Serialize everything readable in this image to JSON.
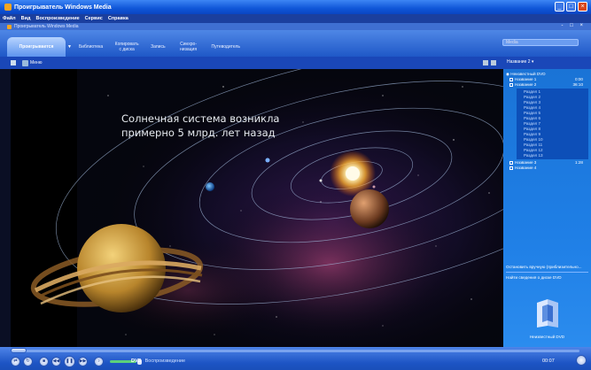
{
  "window": {
    "title": "Проигрыватель Windows Media"
  },
  "menubar": {
    "items": [
      "Файл",
      "Вид",
      "Воспроизведение",
      "Сервис",
      "Справка"
    ]
  },
  "subtitlebar": {
    "title": "Проигрыватель Windows Media"
  },
  "taskbar": {
    "tabs": [
      {
        "label": "Проигрывается"
      },
      {
        "label": "Библиотека"
      },
      {
        "label": "Копировать с диска"
      },
      {
        "label": "Запись"
      },
      {
        "label": "Синхро-низация"
      },
      {
        "label": "Путеводитель"
      }
    ],
    "search_placeholder": "Media"
  },
  "toolbar": {
    "menu_label": "Меню",
    "title_select": "Название 2"
  },
  "video": {
    "caption_line1": "Солнечная система возникла",
    "caption_line2": "примерно 5 млрд. лет назад"
  },
  "playlist": {
    "disc": "Неизвестный DVD",
    "titles": [
      {
        "name": "Название 1",
        "duration": "0:00"
      },
      {
        "name": "Название 2",
        "duration": "36:10"
      }
    ],
    "sections": [
      "Раздел 1",
      "Раздел 2",
      "Раздел 3",
      "Раздел 4",
      "Раздел 5",
      "Раздел 6",
      "Раздел 7",
      "Раздел 8",
      "Раздел 9",
      "Раздел 10",
      "Раздел 11",
      "Раздел 12",
      "Раздел 13"
    ],
    "more_titles": [
      {
        "name": "Название 3",
        "duration": "1:28"
      },
      {
        "name": "Название 4",
        "duration": ""
      }
    ],
    "stop_time": "Остановить вручную (приблизительно...",
    "find_info": "Найти сведения о диске DVD",
    "dvd_caption": "Неизвестный DVD"
  },
  "player": {
    "state_label": "Воспроизведение",
    "state_prefix": "DVD",
    "elapsed": "00:07"
  },
  "colors": {
    "accent": "#1f58c7",
    "playlist_bg": "#1f7fe6",
    "caption": "#e8ecf0"
  }
}
